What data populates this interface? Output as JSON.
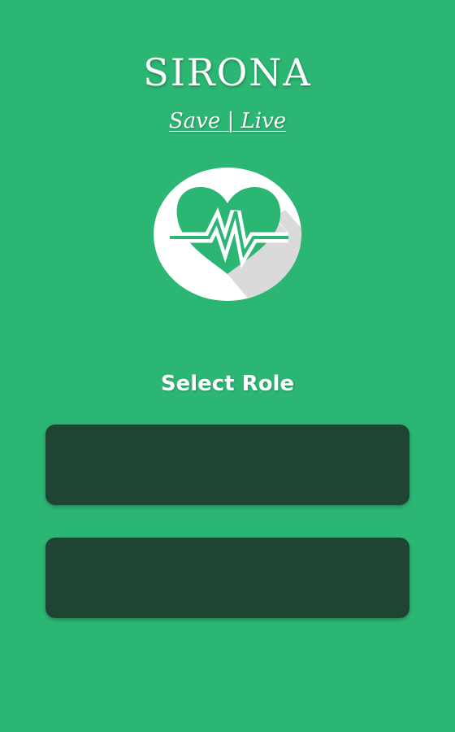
{
  "header": {
    "app_title": "SIRONA",
    "tagline": "Save | Live"
  },
  "logo": {
    "icon": "heart-pulse-icon",
    "background_color": "#ffffff",
    "accent_color": "#2cb673"
  },
  "role_selection": {
    "heading": "Select Role",
    "buttons": [
      {
        "label": ""
      },
      {
        "label": ""
      }
    ]
  },
  "colors": {
    "background": "#2cb673",
    "button": "#1f4433",
    "text": "#ffffff"
  }
}
